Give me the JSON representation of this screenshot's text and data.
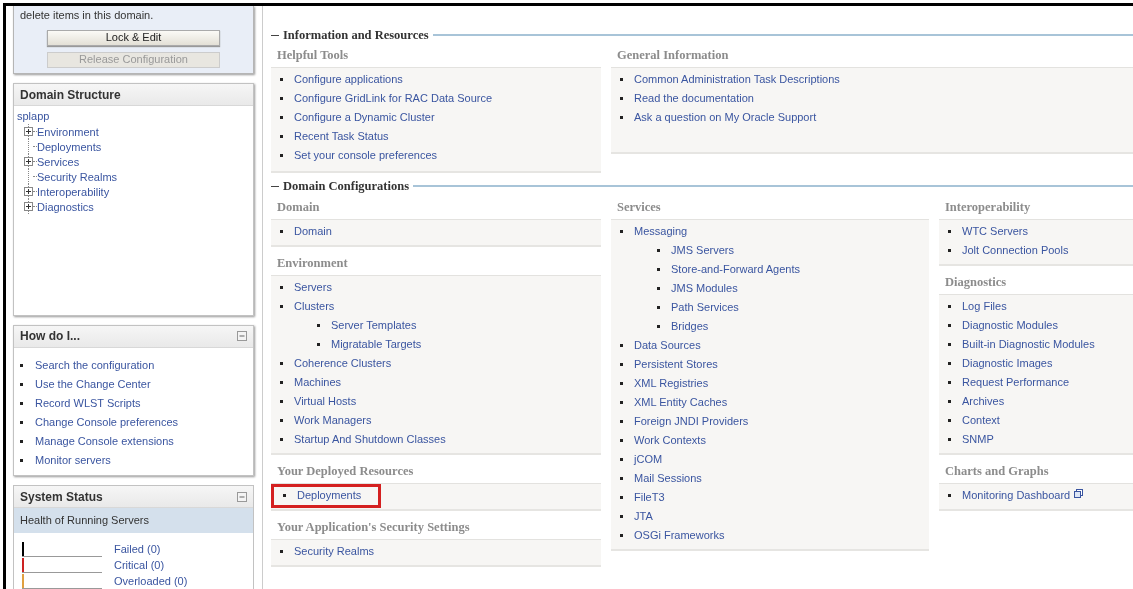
{
  "change_center": {
    "message": "delete items in this domain.",
    "buttons": [
      {
        "label": "Lock & Edit",
        "disabled": false
      },
      {
        "label": "Release Configuration",
        "disabled": true
      }
    ]
  },
  "domain_structure": {
    "title": "Domain Structure",
    "root": "splapp",
    "children": [
      {
        "label": "Environment",
        "expandable": true
      },
      {
        "label": "Deployments",
        "expandable": false
      },
      {
        "label": "Services",
        "expandable": true
      },
      {
        "label": "Security Realms",
        "expandable": false
      },
      {
        "label": "Interoperability",
        "expandable": true
      },
      {
        "label": "Diagnostics",
        "expandable": true
      }
    ]
  },
  "how_do_i": {
    "title": "How do I...",
    "links": [
      "Search the configuration",
      "Use the Change Center",
      "Record WLST Scripts",
      "Change Console preferences",
      "Manage Console extensions",
      "Monitor servers"
    ]
  },
  "system_status": {
    "title": "System Status",
    "subtitle": "Health of Running Servers",
    "rows": [
      {
        "label": "Failed (0)",
        "color": "#000000"
      },
      {
        "label": "Critical (0)",
        "color": "#cc2222"
      },
      {
        "label": "Overloaded (0)",
        "color": "#e0a040"
      }
    ]
  },
  "information_and_resources": {
    "title": "Information and Resources",
    "groups": [
      {
        "title": "Helpful Tools",
        "links": [
          {
            "label": "Configure applications"
          },
          {
            "label": "Configure GridLink for RAC Data Source"
          },
          {
            "label": "Configure a Dynamic Cluster"
          },
          {
            "label": "Recent Task Status"
          },
          {
            "label": "Set your console preferences"
          }
        ]
      },
      {
        "title": "General Information",
        "links": [
          {
            "label": "Common Administration Task Descriptions"
          },
          {
            "label": "Read the documentation"
          },
          {
            "label": "Ask a question on My Oracle Support"
          }
        ]
      }
    ]
  },
  "domain_configurations": {
    "title": "Domain Configurations",
    "columns": [
      [
        {
          "title": "Domain",
          "links": [
            {
              "label": "Domain"
            }
          ]
        },
        {
          "title": "Environment",
          "links": [
            {
              "label": "Servers"
            },
            {
              "label": "Clusters",
              "children": [
                {
                  "label": "Server Templates"
                },
                {
                  "label": "Migratable Targets"
                }
              ]
            },
            {
              "label": "Coherence Clusters"
            },
            {
              "label": "Machines"
            },
            {
              "label": "Virtual Hosts"
            },
            {
              "label": "Work Managers"
            },
            {
              "label": "Startup And Shutdown Classes"
            }
          ]
        },
        {
          "title": "Your Deployed Resources",
          "links": [
            {
              "label": "Deployments",
              "highlighted": true
            }
          ]
        },
        {
          "title": "Your Application's Security Settings",
          "links": [
            {
              "label": "Security Realms"
            }
          ]
        }
      ],
      [
        {
          "title": "Services",
          "links": [
            {
              "label": "Messaging",
              "children": [
                {
                  "label": "JMS Servers"
                },
                {
                  "label": "Store-and-Forward Agents"
                },
                {
                  "label": "JMS Modules"
                },
                {
                  "label": "Path Services"
                },
                {
                  "label": "Bridges"
                }
              ]
            },
            {
              "label": "Data Sources"
            },
            {
              "label": "Persistent Stores"
            },
            {
              "label": "XML Registries"
            },
            {
              "label": "XML Entity Caches"
            },
            {
              "label": "Foreign JNDI Providers"
            },
            {
              "label": "Work Contexts"
            },
            {
              "label": "jCOM"
            },
            {
              "label": "Mail Sessions"
            },
            {
              "label": "FileT3"
            },
            {
              "label": "JTA"
            },
            {
              "label": "OSGi Frameworks"
            }
          ]
        }
      ],
      [
        {
          "title": "Interoperability",
          "links": [
            {
              "label": "WTC Servers"
            },
            {
              "label": "Jolt Connection Pools"
            }
          ]
        },
        {
          "title": "Diagnostics",
          "links": [
            {
              "label": "Log Files"
            },
            {
              "label": "Diagnostic Modules"
            },
            {
              "label": "Built-in Diagnostic Modules"
            },
            {
              "label": "Diagnostic Images"
            },
            {
              "label": "Request Performance"
            },
            {
              "label": "Archives"
            },
            {
              "label": "Context"
            },
            {
              "label": "SNMP"
            }
          ]
        },
        {
          "title": "Charts and Graphs",
          "links": [
            {
              "label": "Monitoring Dashboard",
              "external": true
            }
          ]
        }
      ]
    ]
  }
}
